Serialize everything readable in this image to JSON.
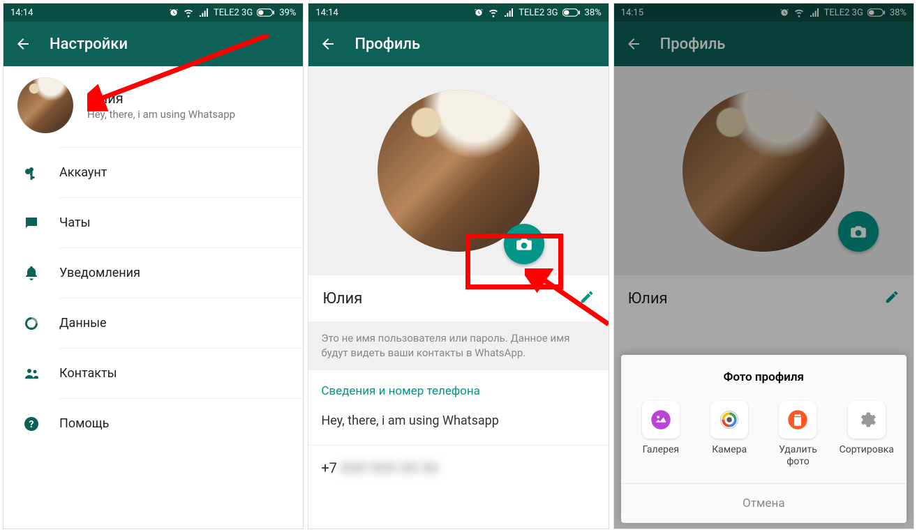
{
  "screens": [
    {
      "statusbar": {
        "time": "14:14",
        "carrier": "TELE2 3G",
        "battery": "39%"
      },
      "appbar_title": "Настройки",
      "profile": {
        "name": "Юлия",
        "status": "Hey, there, i am using Whatsapp"
      },
      "menu": {
        "account": "Аккаунт",
        "chats": "Чаты",
        "notifications": "Уведомления",
        "data": "Данные",
        "contacts": "Контакты",
        "help": "Помощь"
      }
    },
    {
      "statusbar": {
        "time": "14:14",
        "carrier": "TELE2 3G",
        "battery": "38%"
      },
      "appbar_title": "Профиль",
      "name": "Юлия",
      "hint": "Это не имя пользователя или пароль. Данное имя будут видеть ваши контакты в WhatsApp.",
      "section_link": "Сведения и номер телефона",
      "status": "Hey, there, i am using Whatsapp",
      "phone_prefix": "+7",
      "phone_blurred": "XXX XXX XX XX"
    },
    {
      "statusbar": {
        "time": "14:15",
        "carrier": "TELE2 3G",
        "battery": "38%"
      },
      "appbar_title": "Профиль",
      "name": "Юлия",
      "sheet": {
        "title": "Фото профиля",
        "gallery": "Галерея",
        "camera": "Камера",
        "delete": "Удалить фото",
        "sort": "Сортировка",
        "cancel": "Отмена"
      }
    }
  ]
}
